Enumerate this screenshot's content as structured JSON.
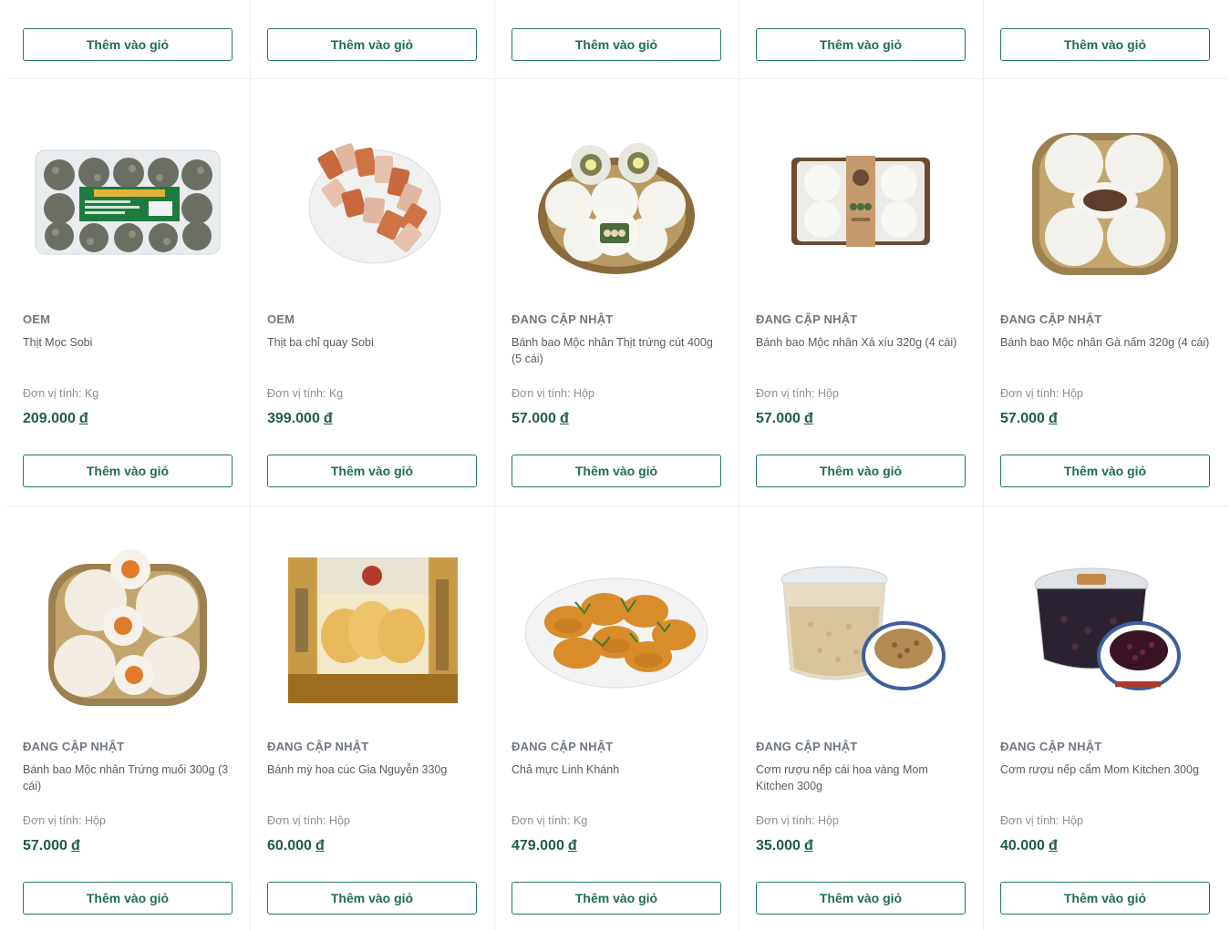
{
  "add_to_cart_label": "Thêm vào giỏ",
  "unit_prefix": "Đơn vị tính:",
  "currency_symbol": "đ",
  "colors": {
    "accent": "#1f7a56",
    "price": "#1c5f45",
    "border": "#eeeeee"
  },
  "top_row_buttons": 5,
  "products": [
    {
      "brand": "OEM",
      "name": "Thịt Mọc Sobi",
      "unit": "Kg",
      "price": "209.000",
      "image": "meatball-tray-image"
    },
    {
      "brand": "OEM",
      "name": "Thịt ba chỉ quay Sobi",
      "unit": "Kg",
      "price": "399.000",
      "image": "roast-pork-image"
    },
    {
      "brand": "ĐANG CẬP NHẬT",
      "name": "Bánh bao Mộc nhân Thịt trứng cút 400g (5 cái)",
      "unit": "Hộp",
      "price": "57.000",
      "image": "steamed-bun-basket-image"
    },
    {
      "brand": "ĐANG CẬP NHẬT",
      "name": "Bánh bao Mộc nhân Xá xíu 320g (4 cái)",
      "unit": "Hộp",
      "price": "57.000",
      "image": "steamed-bun-box-image"
    },
    {
      "brand": "ĐANG CẬP NHẬT",
      "name": "Bánh bao Mộc nhân Gà nấm 320g (4 cái)",
      "unit": "Hộp",
      "price": "57.000",
      "image": "chicken-bun-basket-image"
    },
    {
      "brand": "ĐANG CẬP NHẬT",
      "name": "Bánh bao Mộc nhân Trứng muối 300g (3 cái)",
      "unit": "Hộp",
      "price": "57.000",
      "image": "salted-egg-bun-image"
    },
    {
      "brand": "ĐANG CẬP NHẬT",
      "name": "Bánh mỳ hoa cúc Gia Nguyễn 330g",
      "unit": "Hộp",
      "price": "60.000",
      "image": "brioche-bag-image"
    },
    {
      "brand": "ĐANG CẬP NHẬT",
      "name": "Chả mực Linh Khánh",
      "unit": "Kg",
      "price": "479.000",
      "image": "squid-cake-plate-image"
    },
    {
      "brand": "ĐANG CẬP NHẬT",
      "name": "Cơm rượu nếp cái hoa vàng Mom Kitchen 300g",
      "unit": "Hộp",
      "price": "35.000",
      "image": "rice-wine-tub-image"
    },
    {
      "brand": "ĐANG CẬP NHẬT",
      "name": "Cơm rượu nếp cẩm Mom Kitchen 300g",
      "unit": "Hộp",
      "price": "40.000",
      "image": "black-rice-wine-tub-image"
    }
  ]
}
